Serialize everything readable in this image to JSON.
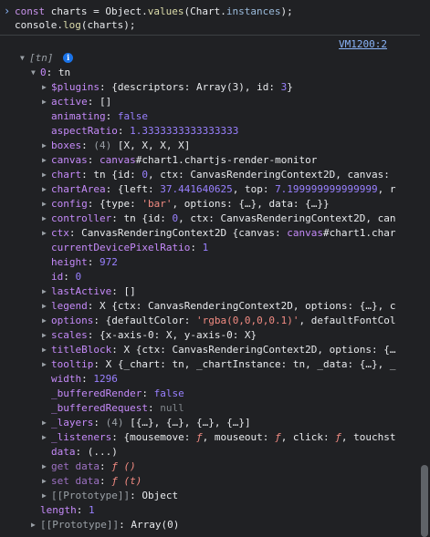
{
  "console": {
    "prompt": "›",
    "input": {
      "line1": {
        "kw": "const",
        "var": "charts",
        "eq": " = ",
        "obj": "Object",
        "dot1": ".",
        "method": "values",
        "open": "(",
        "cls": "Chart",
        "dot2": ".",
        "prop": "instances",
        "close": ");"
      },
      "line2": {
        "obj": "console",
        "dot": ".",
        "method": "log",
        "args": "(charts);"
      }
    },
    "source_link": "VM1200:2",
    "rows": [
      {
        "indent": 0,
        "arrow": "▼",
        "segments": [
          {
            "c": "ital gray",
            "t": "[tn] "
          }
        ],
        "badge": "i"
      },
      {
        "indent": 1,
        "arrow": "▼",
        "segments": [
          {
            "c": "key",
            "t": "0"
          },
          {
            "c": "cls",
            "t": ": tn"
          }
        ]
      },
      {
        "indent": 2,
        "arrow": "▶",
        "segments": [
          {
            "c": "key",
            "t": "$plugins"
          },
          {
            "c": "cls",
            "t": ": {descriptors: Array(3), id: "
          },
          {
            "c": "num",
            "t": "3"
          },
          {
            "c": "cls",
            "t": "}"
          }
        ]
      },
      {
        "indent": 2,
        "arrow": "▶",
        "segments": [
          {
            "c": "key",
            "t": "active"
          },
          {
            "c": "cls",
            "t": ": []"
          }
        ]
      },
      {
        "indent": 2,
        "arrow": "",
        "segments": [
          {
            "c": "key",
            "t": "animating"
          },
          {
            "c": "cls",
            "t": ": "
          },
          {
            "c": "bool",
            "t": "false"
          }
        ]
      },
      {
        "indent": 2,
        "arrow": "",
        "segments": [
          {
            "c": "key",
            "t": "aspectRatio"
          },
          {
            "c": "cls",
            "t": ": "
          },
          {
            "c": "num",
            "t": "1.3333333333333333"
          }
        ]
      },
      {
        "indent": 2,
        "arrow": "▶",
        "segments": [
          {
            "c": "key",
            "t": "boxes"
          },
          {
            "c": "cls",
            "t": ": "
          },
          {
            "c": "gray",
            "t": "(4) "
          },
          {
            "c": "cls",
            "t": "[X, X, X, X]"
          }
        ]
      },
      {
        "indent": 2,
        "arrow": "▶",
        "segments": [
          {
            "c": "key",
            "t": "canvas"
          },
          {
            "c": "cls",
            "t": ": "
          },
          {
            "c": "elem",
            "t": "canvas"
          },
          {
            "c": "cls",
            "t": "#chart1.chartjs-render-monitor"
          }
        ]
      },
      {
        "indent": 2,
        "arrow": "▶",
        "segments": [
          {
            "c": "key",
            "t": "chart"
          },
          {
            "c": "cls",
            "t": ": tn {id: "
          },
          {
            "c": "num",
            "t": "0"
          },
          {
            "c": "cls",
            "t": ", ctx: CanvasRenderingContext2D, canvas:"
          }
        ]
      },
      {
        "indent": 2,
        "arrow": "▶",
        "segments": [
          {
            "c": "key",
            "t": "chartArea"
          },
          {
            "c": "cls",
            "t": ": {left: "
          },
          {
            "c": "num",
            "t": "37.441640625"
          },
          {
            "c": "cls",
            "t": ", top: "
          },
          {
            "c": "num",
            "t": "7.199999999999999"
          },
          {
            "c": "cls",
            "t": ", r"
          }
        ]
      },
      {
        "indent": 2,
        "arrow": "▶",
        "segments": [
          {
            "c": "key",
            "t": "config"
          },
          {
            "c": "cls",
            "t": ": {type: "
          },
          {
            "c": "str",
            "t": "'bar'"
          },
          {
            "c": "cls",
            "t": ", options: {…}, data: {…}}"
          }
        ]
      },
      {
        "indent": 2,
        "arrow": "▶",
        "segments": [
          {
            "c": "key",
            "t": "controller"
          },
          {
            "c": "cls",
            "t": ": tn {id: "
          },
          {
            "c": "num",
            "t": "0"
          },
          {
            "c": "cls",
            "t": ", ctx: CanvasRenderingContext2D, can"
          }
        ]
      },
      {
        "indent": 2,
        "arrow": "▶",
        "segments": [
          {
            "c": "key",
            "t": "ctx"
          },
          {
            "c": "cls",
            "t": ": CanvasRenderingContext2D {canvas: "
          },
          {
            "c": "elem",
            "t": "canvas"
          },
          {
            "c": "cls",
            "t": "#chart1.char"
          }
        ]
      },
      {
        "indent": 2,
        "arrow": "",
        "segments": [
          {
            "c": "key",
            "t": "currentDevicePixelRatio"
          },
          {
            "c": "cls",
            "t": ": "
          },
          {
            "c": "num",
            "t": "1"
          }
        ]
      },
      {
        "indent": 2,
        "arrow": "",
        "segments": [
          {
            "c": "key",
            "t": "height"
          },
          {
            "c": "cls",
            "t": ": "
          },
          {
            "c": "num",
            "t": "972"
          }
        ]
      },
      {
        "indent": 2,
        "arrow": "",
        "segments": [
          {
            "c": "key",
            "t": "id"
          },
          {
            "c": "cls",
            "t": ": "
          },
          {
            "c": "num",
            "t": "0"
          }
        ]
      },
      {
        "indent": 2,
        "arrow": "▶",
        "segments": [
          {
            "c": "key",
            "t": "lastActive"
          },
          {
            "c": "cls",
            "t": ": []"
          }
        ]
      },
      {
        "indent": 2,
        "arrow": "▶",
        "segments": [
          {
            "c": "key",
            "t": "legend"
          },
          {
            "c": "cls",
            "t": ": X {ctx: CanvasRenderingContext2D, options: {…}, c"
          }
        ]
      },
      {
        "indent": 2,
        "arrow": "▶",
        "segments": [
          {
            "c": "key",
            "t": "options"
          },
          {
            "c": "cls",
            "t": ": {defaultColor: "
          },
          {
            "c": "str",
            "t": "'rgba(0,0,0,0.1)'"
          },
          {
            "c": "cls",
            "t": ", defaultFontCol"
          }
        ]
      },
      {
        "indent": 2,
        "arrow": "▶",
        "segments": [
          {
            "c": "key",
            "t": "scales"
          },
          {
            "c": "cls",
            "t": ": {x-axis-0: X, y-axis-0: X}"
          }
        ]
      },
      {
        "indent": 2,
        "arrow": "▶",
        "segments": [
          {
            "c": "key",
            "t": "titleBlock"
          },
          {
            "c": "cls",
            "t": ": X {ctx: CanvasRenderingContext2D, options: {…"
          }
        ]
      },
      {
        "indent": 2,
        "arrow": "▶",
        "segments": [
          {
            "c": "key",
            "t": "tooltip"
          },
          {
            "c": "cls",
            "t": ": X {_chart: tn, _chartInstance: tn, _data: {…}, _"
          }
        ]
      },
      {
        "indent": 2,
        "arrow": "",
        "segments": [
          {
            "c": "key",
            "t": "width"
          },
          {
            "c": "cls",
            "t": ": "
          },
          {
            "c": "num",
            "t": "1296"
          }
        ]
      },
      {
        "indent": 2,
        "arrow": "",
        "segments": [
          {
            "c": "key",
            "t": "_bufferedRender"
          },
          {
            "c": "cls",
            "t": ": "
          },
          {
            "c": "bool",
            "t": "false"
          }
        ]
      },
      {
        "indent": 2,
        "arrow": "",
        "segments": [
          {
            "c": "key",
            "t": "_bufferedRequest"
          },
          {
            "c": "cls",
            "t": ": "
          },
          {
            "c": "nul",
            "t": "null"
          }
        ]
      },
      {
        "indent": 2,
        "arrow": "▶",
        "segments": [
          {
            "c": "key",
            "t": "_layers"
          },
          {
            "c": "cls",
            "t": ": "
          },
          {
            "c": "gray",
            "t": "(4) "
          },
          {
            "c": "cls",
            "t": "[{…}, {…}, {…}, {…}]"
          }
        ]
      },
      {
        "indent": 2,
        "arrow": "▶",
        "segments": [
          {
            "c": "key",
            "t": "_listeners"
          },
          {
            "c": "cls",
            "t": ": {mousemove: "
          },
          {
            "c": "fi",
            "t": "ƒ"
          },
          {
            "c": "cls",
            "t": ", mouseout: "
          },
          {
            "c": "fi",
            "t": "ƒ"
          },
          {
            "c": "cls",
            "t": ", click: "
          },
          {
            "c": "fi",
            "t": "ƒ"
          },
          {
            "c": "cls",
            "t": ", touchst"
          }
        ]
      },
      {
        "indent": 2,
        "arrow": "",
        "segments": [
          {
            "c": "key",
            "t": "data"
          },
          {
            "c": "cls",
            "t": ": (...)"
          }
        ]
      },
      {
        "indent": 2,
        "arrow": "▶",
        "segments": [
          {
            "c": "key-dim",
            "t": "get data"
          },
          {
            "c": "cls",
            "t": ": "
          },
          {
            "c": "fi",
            "t": "ƒ ()"
          }
        ]
      },
      {
        "indent": 2,
        "arrow": "▶",
        "segments": [
          {
            "c": "key-dim",
            "t": "set data"
          },
          {
            "c": "cls",
            "t": ": "
          },
          {
            "c": "fi",
            "t": "ƒ (t)"
          }
        ]
      },
      {
        "indent": 2,
        "arrow": "▶",
        "segments": [
          {
            "c": "gray",
            "t": "[[Prototype]]"
          },
          {
            "c": "cls",
            "t": ": Object"
          }
        ]
      },
      {
        "indent": 1,
        "arrow": "",
        "segments": [
          {
            "c": "key",
            "t": "length"
          },
          {
            "c": "cls",
            "t": ": "
          },
          {
            "c": "num",
            "t": "1"
          }
        ]
      },
      {
        "indent": 1,
        "arrow": "▶",
        "segments": [
          {
            "c": "gray",
            "t": "[[Prototype]]"
          },
          {
            "c": "cls",
            "t": ": Array(0)"
          }
        ]
      }
    ]
  }
}
